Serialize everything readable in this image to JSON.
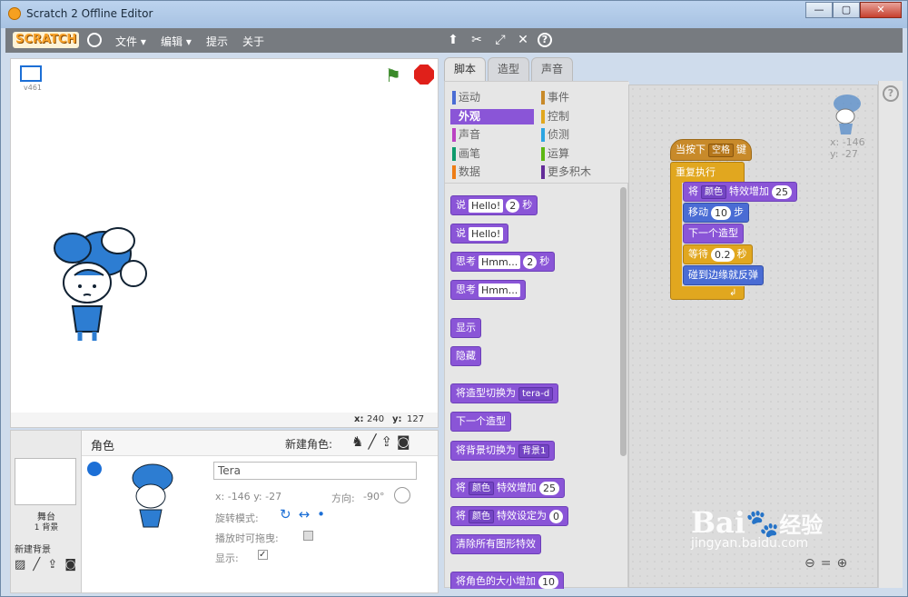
{
  "window": {
    "title": "Scratch 2 Offline Editor",
    "min": "—",
    "max": "▢",
    "close": "✕"
  },
  "menu": {
    "logo": "SCRATCH",
    "file": "文件 ▾",
    "edit": "编辑 ▾",
    "tips": "提示",
    "about": "关于"
  },
  "stage": {
    "version": "v461",
    "mouse_x_label": "x:",
    "mouse_x": "240",
    "mouse_y_label": "y:",
    "mouse_y": "127"
  },
  "sprites": {
    "header": "角色",
    "new_sprite": "新建角色:",
    "stage_label": "舞台",
    "stage_backdrops": "1 背景",
    "new_backdrop": "新建背景"
  },
  "sprite_info": {
    "name": "Tera",
    "x_label": "x:",
    "x": "-146",
    "y_label": "y:",
    "y": "-27",
    "dir_label": "方向:",
    "dir": "-90°",
    "rot_label": "旋转模式:",
    "drag_label": "播放时可拖曳:",
    "show_label": "显示:"
  },
  "tabs": {
    "scripts": "脚本",
    "costumes": "造型",
    "sounds": "声音"
  },
  "categories": [
    {
      "label": "运动",
      "color": "#4a6cd4"
    },
    {
      "label": "事件",
      "color": "#c88a2a"
    },
    {
      "label": "外观",
      "color": "#8a55d7"
    },
    {
      "label": "控制",
      "color": "#e1a71f"
    },
    {
      "label": "声音",
      "color": "#bb42c3"
    },
    {
      "label": "侦测",
      "color": "#2ca5e2"
    },
    {
      "label": "画笔",
      "color": "#0e9a6c"
    },
    {
      "label": "运算",
      "color": "#5cb712"
    },
    {
      "label": "数据",
      "color": "#ee7d16"
    },
    {
      "label": "更多积木",
      "color": "#632d99"
    }
  ],
  "palette": {
    "say_timed": {
      "a": "说",
      "b": "Hello!",
      "c": "2",
      "d": "秒"
    },
    "say": {
      "a": "说",
      "b": "Hello!"
    },
    "think_timed": {
      "a": "思考",
      "b": "Hmm...",
      "c": "2",
      "d": "秒"
    },
    "think": {
      "a": "思考",
      "b": "Hmm..."
    },
    "show": "显示",
    "hide": "隐藏",
    "switch_costume": {
      "a": "将造型切换为",
      "b": "tera-d"
    },
    "next_costume": "下一个造型",
    "switch_backdrop": {
      "a": "将背景切换为",
      "b": "背景1"
    },
    "change_effect": {
      "a": "将",
      "b": "颜色",
      "c": "特效增加",
      "d": "25"
    },
    "set_effect": {
      "a": "将",
      "b": "颜色",
      "c": "特效设定为",
      "d": "0"
    },
    "clear_effects": "清除所有图形特效",
    "change_size": {
      "a": "将角色的大小增加",
      "b": "10"
    }
  },
  "script": {
    "hat": {
      "a": "当按下",
      "b": "空格",
      "c": "键"
    },
    "forever": "重复执行",
    "effect": {
      "a": "将",
      "b": "颜色",
      "c": "特效增加",
      "d": "25"
    },
    "move": {
      "a": "移动",
      "b": "10",
      "c": "步"
    },
    "next": "下一个造型",
    "wait": {
      "a": "等待",
      "b": "0.2",
      "c": "秒"
    },
    "bounce": "碰到边缘就反弹",
    "sprite_x": "x: -146",
    "sprite_y": "y: -27"
  },
  "watermark": {
    "brand": "Bai",
    "brand2": "经验",
    "site": "jingyan.baidu.com"
  }
}
